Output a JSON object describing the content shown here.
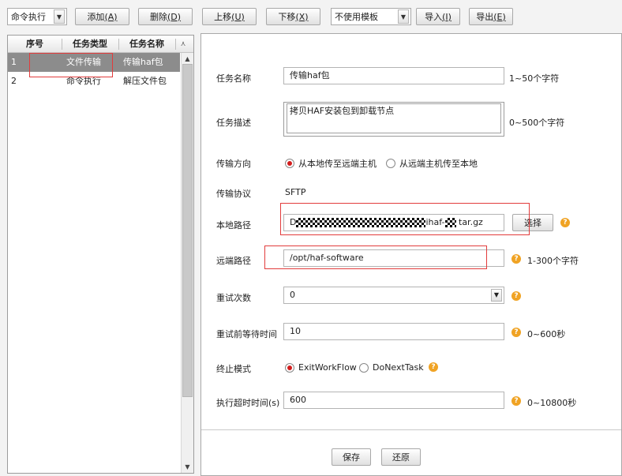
{
  "toolbar": {
    "task_type_select": "命令执行",
    "add_label": "添加",
    "add_key": "(A)",
    "delete_label": "删除",
    "delete_key": "(D)",
    "move_up_label": "上移",
    "move_up_key": "(U)",
    "move_down_label": "下移",
    "move_down_key": "(X)",
    "template_select": "不使用模板",
    "import_label": "导入",
    "import_key": "(I)",
    "export_label": "导出",
    "export_key": "(E)"
  },
  "task_table": {
    "columns": [
      "序号",
      "任务类型",
      "任务名称"
    ],
    "rows": [
      {
        "no": "1",
        "type": "文件传输",
        "name": "传输haf包",
        "selected": true
      },
      {
        "no": "2",
        "type": "命令执行",
        "name": "解压文件包",
        "selected": false
      }
    ]
  },
  "form": {
    "task_name": {
      "label": "任务名称",
      "value": "传输haf包",
      "hint": "1~50个字符"
    },
    "task_desc": {
      "label": "任务描述",
      "value": "拷贝HAF安装包到卸载节点",
      "hint": "0~500个字符"
    },
    "direction": {
      "label": "传输方向",
      "option1": "从本地传至远端主机",
      "option2": "从远端主机传至本地",
      "selected": "option1"
    },
    "protocol": {
      "label": "传输协议",
      "value": "SFTP"
    },
    "local_path": {
      "label": "本地路径",
      "value_prefix": "D",
      "value_mid": "ihaf-",
      "value_suffix": "tar.gz",
      "choose_label": "选择"
    },
    "remote_path": {
      "label": "远端路径",
      "value": "/opt/haf-software",
      "hint": "1-300个字符"
    },
    "retry_count": {
      "label": "重试次数",
      "value": "0"
    },
    "retry_wait": {
      "label": "重试前等待时间",
      "value": "10",
      "hint": "0~600秒"
    },
    "stop_mode": {
      "label": "终止模式",
      "option1": "ExitWorkFlow",
      "option2": "DoNextTask",
      "selected": "option1"
    },
    "timeout": {
      "label": "执行超时时间(s)",
      "value": "600",
      "hint": "0~10800秒"
    }
  },
  "footer": {
    "save_label": "保存",
    "restore_label": "还原"
  },
  "colors": {
    "selected_row": "#8c8c8c",
    "highlight_box": "#e23c3c",
    "help_icon": "#f0a324",
    "radio_dot": "#d21c1c"
  }
}
